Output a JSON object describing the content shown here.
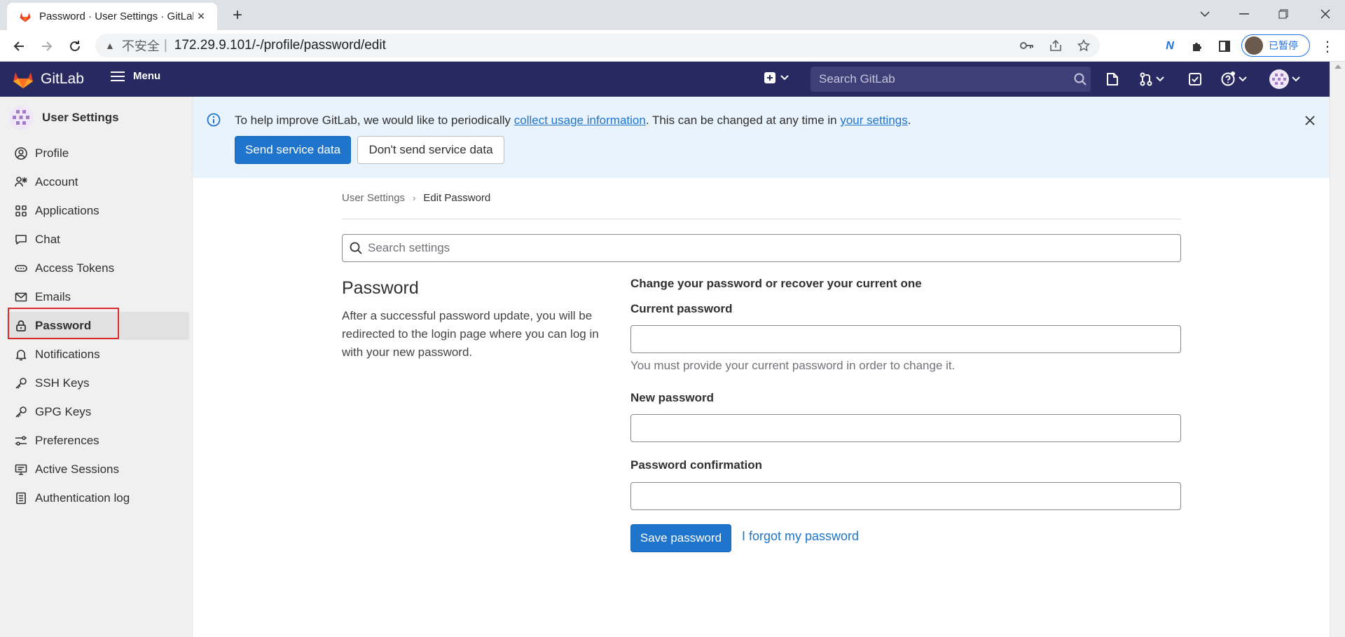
{
  "browser": {
    "tab_title": "Password · User Settings · GitLab",
    "tab_close": "×",
    "new_tab": "+",
    "insecure_label": "不安全",
    "url": "172.29.9.101/-/profile/password/edit",
    "profile_status": "已暂停"
  },
  "header": {
    "brand": "GitLab",
    "menu_label": "Menu",
    "search_placeholder": "Search GitLab"
  },
  "sidebar": {
    "title": "User Settings",
    "items": [
      {
        "label": "Profile",
        "icon": "profile-icon"
      },
      {
        "label": "Account",
        "icon": "account-icon"
      },
      {
        "label": "Applications",
        "icon": "applications-icon"
      },
      {
        "label": "Chat",
        "icon": "chat-icon"
      },
      {
        "label": "Access Tokens",
        "icon": "token-icon"
      },
      {
        "label": "Emails",
        "icon": "mail-icon"
      },
      {
        "label": "Password",
        "icon": "lock-icon",
        "active": true
      },
      {
        "label": "Notifications",
        "icon": "bell-icon"
      },
      {
        "label": "SSH Keys",
        "icon": "key-icon"
      },
      {
        "label": "GPG Keys",
        "icon": "key-icon"
      },
      {
        "label": "Preferences",
        "icon": "preferences-icon"
      },
      {
        "label": "Active Sessions",
        "icon": "monitor-icon"
      },
      {
        "label": "Authentication log",
        "icon": "log-icon"
      }
    ]
  },
  "banner": {
    "text_before": "To help improve GitLab, we would like to periodically ",
    "link1": "collect usage information",
    "text_middle": ". This can be changed at any time in ",
    "link2": "your settings",
    "text_after": ".",
    "send_button": "Send service data",
    "dont_send_button": "Don't send service data"
  },
  "breadcrumb": {
    "parent": "User Settings",
    "current": "Edit Password"
  },
  "main": {
    "search_placeholder": "Search settings",
    "section_title": "Password",
    "section_description": "After a successful password update, you will be redirected to the login page where you can log in with your new password.",
    "form_heading": "Change your password or recover your current one",
    "current_password_label": "Current password",
    "current_password_help": "You must provide your current password in order to change it.",
    "new_password_label": "New password",
    "confirmation_label": "Password confirmation",
    "save_button": "Save password",
    "forgot_link": "I forgot my password"
  },
  "colors": {
    "header_bg": "#292961",
    "primary": "#1f75cb",
    "banner_bg": "#e9f3fc",
    "highlight": "#dd2b2b"
  }
}
